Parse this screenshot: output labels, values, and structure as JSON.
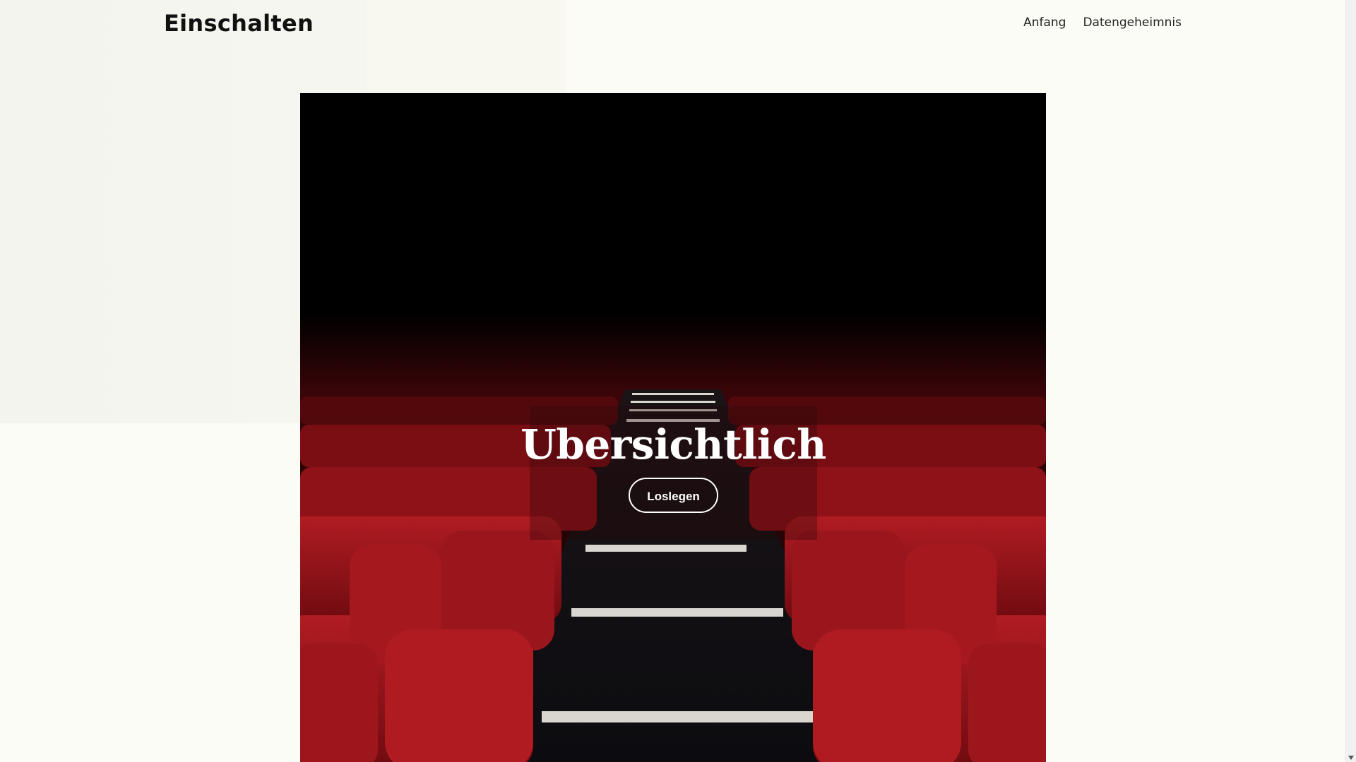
{
  "header": {
    "brand": "Einschalten",
    "nav": [
      {
        "label": "Anfang"
      },
      {
        "label": "Datengeheimnis"
      }
    ]
  },
  "hero": {
    "title": "Ubersichtlich",
    "button_label": "Loslegen",
    "image_subject": "cinema-seats-photo"
  },
  "colors": {
    "background": "#fcfcf7",
    "seat_red": "#a3141b",
    "text_dark": "#111111"
  }
}
